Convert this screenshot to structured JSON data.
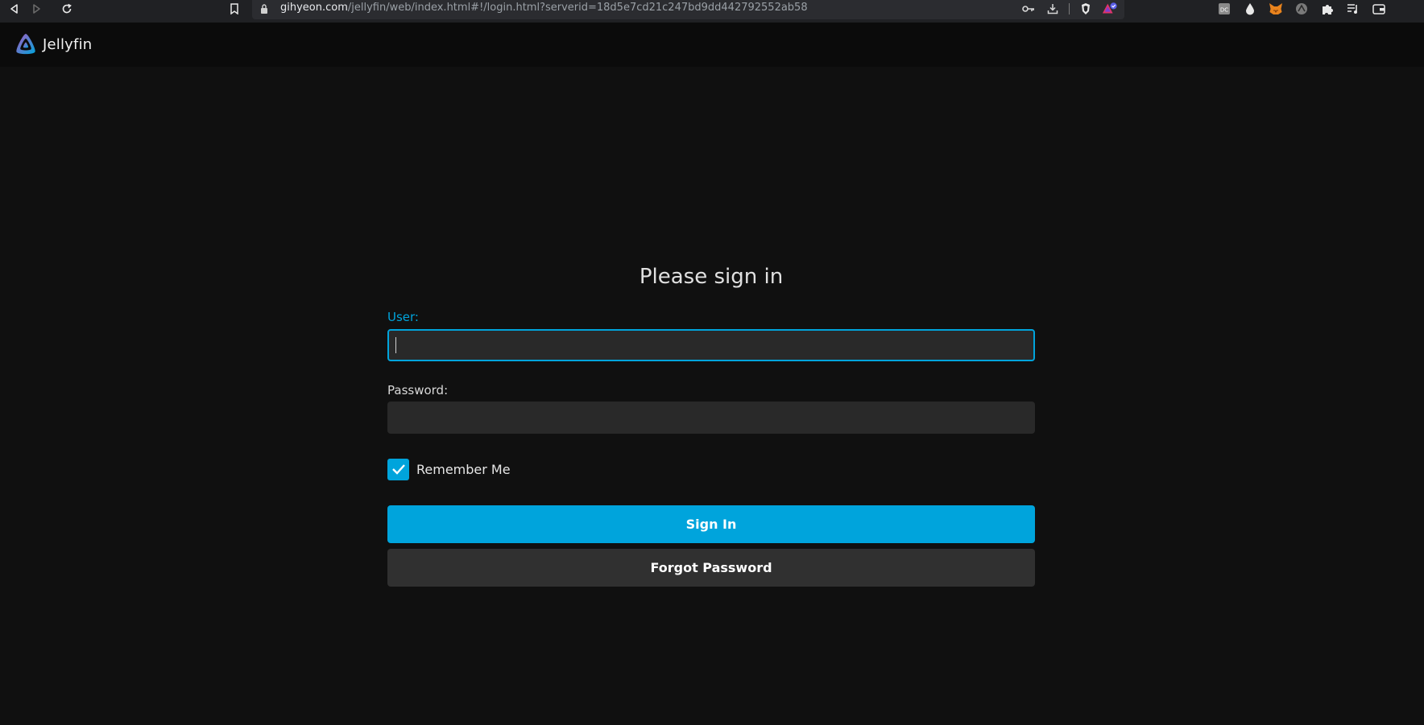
{
  "browser": {
    "url_host": "gihyeon.com",
    "url_path": "/jellyfin/web/index.html#!/login.html?serverid=18d5e7cd21c247bd9dd442792552ab58",
    "ext_dc_label": "DC"
  },
  "app": {
    "name": "Jellyfin",
    "brand_color_start": "#aa5cc3",
    "brand_color_end": "#00a4dc"
  },
  "login": {
    "title": "Please sign in",
    "user_label": "User:",
    "user_value": "",
    "password_label": "Password:",
    "password_value": "",
    "remember_label": "Remember Me",
    "remember_checked": true,
    "signin_label": "Sign In",
    "forgot_label": "Forgot Password"
  },
  "colors": {
    "accent": "#00a4dc",
    "background": "#101010",
    "input_bg": "#292929",
    "secondary_button": "#303030"
  }
}
